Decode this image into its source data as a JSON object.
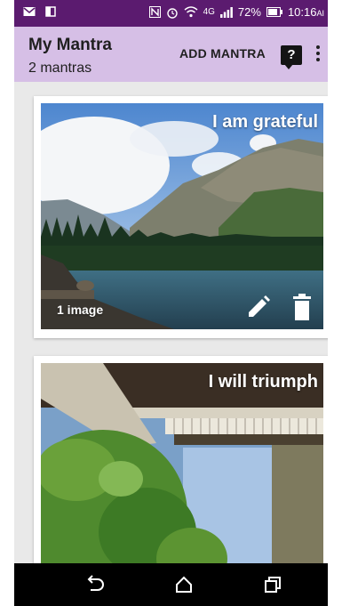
{
  "status_bar": {
    "battery": "72%",
    "time": "10:16",
    "time_suffix": "AI",
    "network": "4G"
  },
  "app_bar": {
    "title": "My Mantra",
    "subtitle": "2 mantras",
    "add_label": "ADD MANTRA",
    "help_label": "?"
  },
  "mantras": [
    {
      "title": "I am grateful",
      "image_count": "1 image"
    },
    {
      "title": "I will triumph"
    }
  ],
  "colors": {
    "status_bar": "#5b1b6f",
    "app_bar": "#d6bfe6",
    "background": "#e9e9e9"
  }
}
